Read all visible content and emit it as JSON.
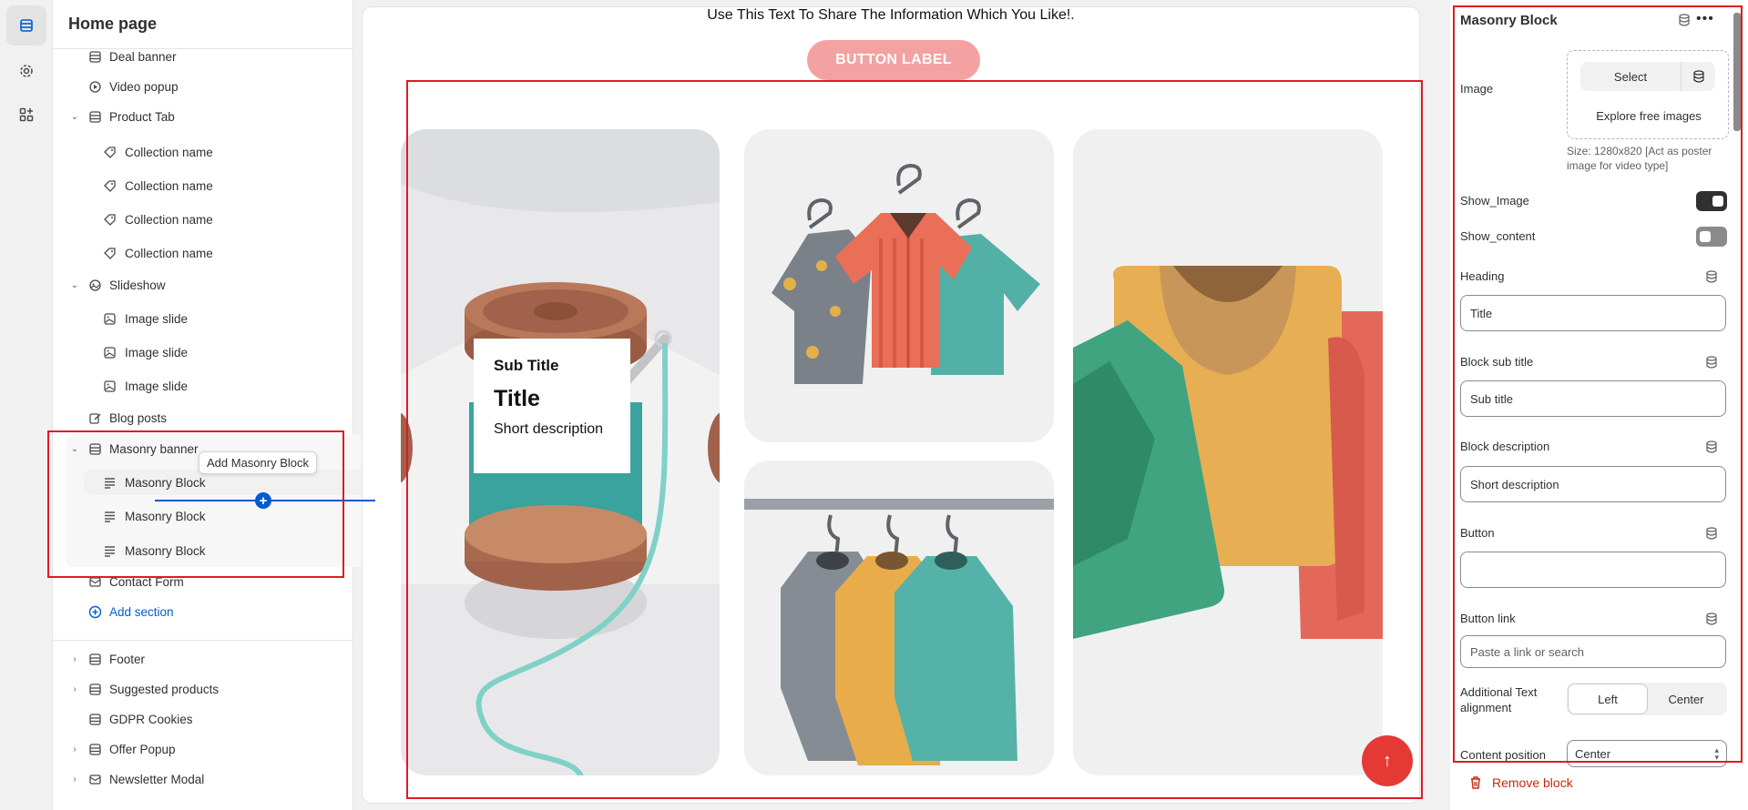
{
  "sidebar": {
    "title": "Home page",
    "items": [
      {
        "label": "Deal banner",
        "level": 1,
        "icon": "section-icon"
      },
      {
        "label": "Video popup",
        "level": 1,
        "icon": "play-icon"
      },
      {
        "label": "Product Tab",
        "level": 1,
        "icon": "section-icon",
        "expanded": true
      },
      {
        "label": "Collection name",
        "level": 2,
        "icon": "tag-icon"
      },
      {
        "label": "Collection name",
        "level": 2,
        "icon": "tag-icon"
      },
      {
        "label": "Collection name",
        "level": 2,
        "icon": "tag-icon"
      },
      {
        "label": "Collection name",
        "level": 2,
        "icon": "tag-icon"
      },
      {
        "label": "Slideshow",
        "level": 1,
        "icon": "slideshow-icon",
        "expanded": true
      },
      {
        "label": "Image slide",
        "level": 2,
        "icon": "image-icon"
      },
      {
        "label": "Image slide",
        "level": 2,
        "icon": "image-icon"
      },
      {
        "label": "Image slide",
        "level": 2,
        "icon": "image-icon"
      },
      {
        "label": "Blog posts",
        "level": 1,
        "icon": "edit-icon"
      },
      {
        "label": "Masonry banner",
        "level": 1,
        "icon": "section-icon",
        "expanded": true
      },
      {
        "label": "Masonry Block",
        "level": 2,
        "icon": "text-block-icon"
      },
      {
        "label": "Masonry Block",
        "level": 2,
        "icon": "text-block-icon"
      },
      {
        "label": "Masonry Block",
        "level": 2,
        "icon": "text-block-icon"
      },
      {
        "label": "Contact Form",
        "level": 1,
        "icon": "mail-icon"
      },
      {
        "label": "Add section",
        "level": 1,
        "icon": "plus-circle-icon"
      },
      {
        "label": "Footer",
        "level": 1,
        "icon": "section-icon"
      },
      {
        "label": "Suggested products",
        "level": 1,
        "icon": "section-icon"
      },
      {
        "label": "GDPR Cookies",
        "level": 1,
        "icon": "section-icon"
      },
      {
        "label": "Offer Popup",
        "level": 1,
        "icon": "section-icon"
      },
      {
        "label": "Newsletter Modal",
        "level": 1,
        "icon": "mail-icon"
      }
    ],
    "tooltip": "Add Masonry Block"
  },
  "preview": {
    "share_text": "Use This Text To Share The Information Which You Like!.",
    "button_label": "BUTTON LABEL",
    "caption": {
      "sub_title": "Sub Title",
      "title": "Title",
      "description": "Short description"
    }
  },
  "panel": {
    "title": "Masonry Block",
    "image_label": "Image",
    "select_label": "Select",
    "explore_label": "Explore free images",
    "size_help": "Size: 1280x820 [Act as poster image for video type]",
    "show_image_label": "Show_Image",
    "show_image_on": true,
    "show_content_label": "Show_content",
    "show_content_on": false,
    "heading_label": "Heading",
    "heading_value": "Title",
    "sub_title_label": "Block sub title",
    "sub_title_value": "Sub title",
    "description_label": "Block description",
    "description_value": "Short description",
    "button_label": "Button",
    "button_value": "",
    "button_link_label": "Button link",
    "button_link_placeholder": "Paste a link or search",
    "alignment_label": "Additional Text alignment",
    "alignment_options": [
      "Left",
      "Center"
    ],
    "alignment_selected": "Left",
    "content_position_label": "Content position",
    "content_position_value": "Center",
    "remove_label": "Remove block"
  },
  "colors": {
    "accent_blue": "#005bd3",
    "highlight_red": "#e01b22",
    "preview_button": "#f4a1a1",
    "fab_red": "#e53935",
    "remove_red": "#c5280c"
  }
}
